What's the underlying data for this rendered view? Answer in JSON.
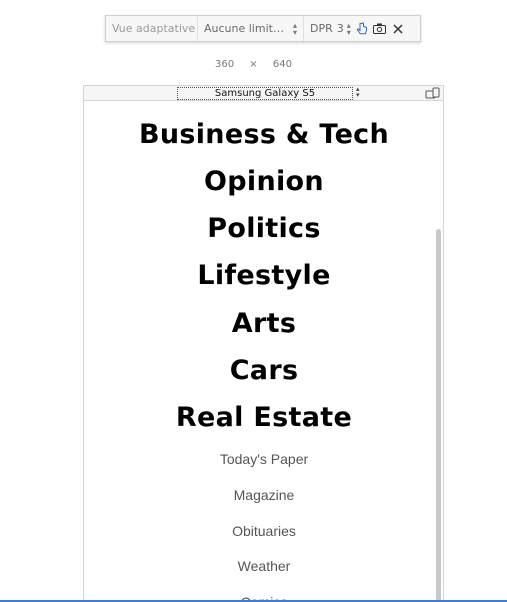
{
  "toolbar": {
    "mode_label": "Vue adaptative",
    "throttle_value": "Aucune limitati...",
    "dpr_label": "DPR",
    "dpr_value": "3"
  },
  "viewport_size": {
    "width": "360",
    "times": "×",
    "height": "640"
  },
  "device_selector": {
    "value": "Samsung Galaxy S5"
  },
  "page": {
    "sections": [
      "Business & Tech",
      "Opinion",
      "Politics",
      "Lifestyle",
      "Arts",
      "Cars",
      "Real Estate"
    ],
    "links": [
      "Today's Paper",
      "Magazine",
      "Obituaries",
      "Weather",
      "Comics"
    ]
  },
  "icons": [
    "chevron-updown-icon",
    "touch-icon",
    "camera-icon",
    "close-icon",
    "rotate-device-icon"
  ],
  "colors": {
    "accent": "#3b7fd0",
    "text": "#000000",
    "link_text": "#555555"
  }
}
